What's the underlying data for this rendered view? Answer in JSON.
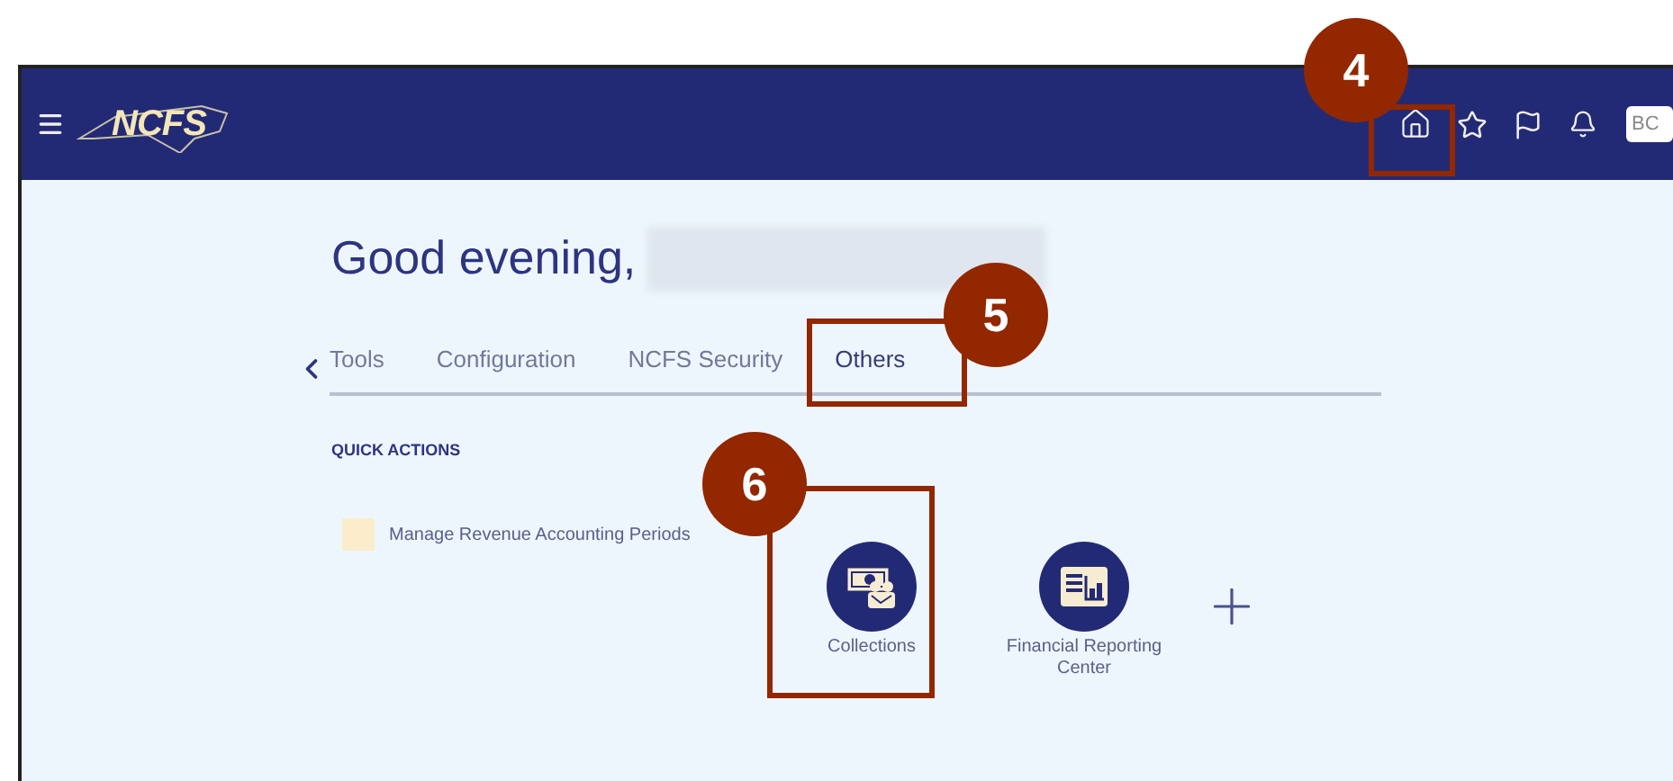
{
  "header": {
    "logo_text": "NCFS",
    "avatar": "BC"
  },
  "greeting": "Good evening,",
  "tabs": [
    {
      "label": "Tools",
      "selected": false
    },
    {
      "label": "Configuration",
      "selected": false
    },
    {
      "label": "NCFS Security",
      "selected": false
    },
    {
      "label": "Others",
      "selected": true
    }
  ],
  "quick_actions": {
    "title": "QUICK ACTIONS",
    "items": [
      {
        "label": "Manage Revenue Accounting Periods"
      }
    ]
  },
  "apps": [
    {
      "kind": "collections",
      "label": "Collections"
    },
    {
      "kind": "report",
      "label": "Financial Reporting Center"
    }
  ],
  "callouts": [
    {
      "number": "4"
    },
    {
      "number": "5"
    },
    {
      "number": "6"
    }
  ]
}
